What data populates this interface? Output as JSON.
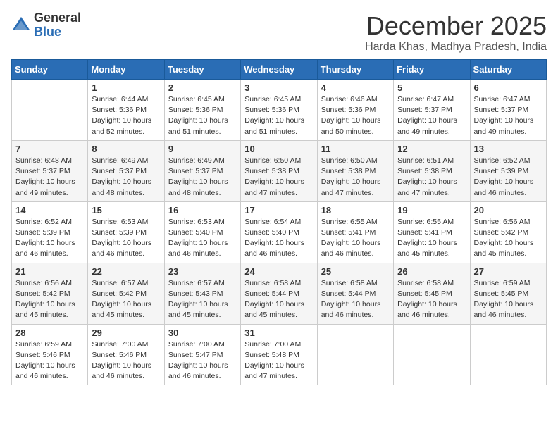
{
  "logo": {
    "general": "General",
    "blue": "Blue"
  },
  "header": {
    "month": "December 2025",
    "location": "Harda Khas, Madhya Pradesh, India"
  },
  "weekdays": [
    "Sunday",
    "Monday",
    "Tuesday",
    "Wednesday",
    "Thursday",
    "Friday",
    "Saturday"
  ],
  "weeks": [
    [
      {
        "day": "",
        "info": ""
      },
      {
        "day": "1",
        "info": "Sunrise: 6:44 AM\nSunset: 5:36 PM\nDaylight: 10 hours\nand 52 minutes."
      },
      {
        "day": "2",
        "info": "Sunrise: 6:45 AM\nSunset: 5:36 PM\nDaylight: 10 hours\nand 51 minutes."
      },
      {
        "day": "3",
        "info": "Sunrise: 6:45 AM\nSunset: 5:36 PM\nDaylight: 10 hours\nand 51 minutes."
      },
      {
        "day": "4",
        "info": "Sunrise: 6:46 AM\nSunset: 5:36 PM\nDaylight: 10 hours\nand 50 minutes."
      },
      {
        "day": "5",
        "info": "Sunrise: 6:47 AM\nSunset: 5:37 PM\nDaylight: 10 hours\nand 49 minutes."
      },
      {
        "day": "6",
        "info": "Sunrise: 6:47 AM\nSunset: 5:37 PM\nDaylight: 10 hours\nand 49 minutes."
      }
    ],
    [
      {
        "day": "7",
        "info": "Sunrise: 6:48 AM\nSunset: 5:37 PM\nDaylight: 10 hours\nand 49 minutes."
      },
      {
        "day": "8",
        "info": "Sunrise: 6:49 AM\nSunset: 5:37 PM\nDaylight: 10 hours\nand 48 minutes."
      },
      {
        "day": "9",
        "info": "Sunrise: 6:49 AM\nSunset: 5:37 PM\nDaylight: 10 hours\nand 48 minutes."
      },
      {
        "day": "10",
        "info": "Sunrise: 6:50 AM\nSunset: 5:38 PM\nDaylight: 10 hours\nand 47 minutes."
      },
      {
        "day": "11",
        "info": "Sunrise: 6:50 AM\nSunset: 5:38 PM\nDaylight: 10 hours\nand 47 minutes."
      },
      {
        "day": "12",
        "info": "Sunrise: 6:51 AM\nSunset: 5:38 PM\nDaylight: 10 hours\nand 47 minutes."
      },
      {
        "day": "13",
        "info": "Sunrise: 6:52 AM\nSunset: 5:39 PM\nDaylight: 10 hours\nand 46 minutes."
      }
    ],
    [
      {
        "day": "14",
        "info": "Sunrise: 6:52 AM\nSunset: 5:39 PM\nDaylight: 10 hours\nand 46 minutes."
      },
      {
        "day": "15",
        "info": "Sunrise: 6:53 AM\nSunset: 5:39 PM\nDaylight: 10 hours\nand 46 minutes."
      },
      {
        "day": "16",
        "info": "Sunrise: 6:53 AM\nSunset: 5:40 PM\nDaylight: 10 hours\nand 46 minutes."
      },
      {
        "day": "17",
        "info": "Sunrise: 6:54 AM\nSunset: 5:40 PM\nDaylight: 10 hours\nand 46 minutes."
      },
      {
        "day": "18",
        "info": "Sunrise: 6:55 AM\nSunset: 5:41 PM\nDaylight: 10 hours\nand 46 minutes."
      },
      {
        "day": "19",
        "info": "Sunrise: 6:55 AM\nSunset: 5:41 PM\nDaylight: 10 hours\nand 45 minutes."
      },
      {
        "day": "20",
        "info": "Sunrise: 6:56 AM\nSunset: 5:42 PM\nDaylight: 10 hours\nand 45 minutes."
      }
    ],
    [
      {
        "day": "21",
        "info": "Sunrise: 6:56 AM\nSunset: 5:42 PM\nDaylight: 10 hours\nand 45 minutes."
      },
      {
        "day": "22",
        "info": "Sunrise: 6:57 AM\nSunset: 5:42 PM\nDaylight: 10 hours\nand 45 minutes."
      },
      {
        "day": "23",
        "info": "Sunrise: 6:57 AM\nSunset: 5:43 PM\nDaylight: 10 hours\nand 45 minutes."
      },
      {
        "day": "24",
        "info": "Sunrise: 6:58 AM\nSunset: 5:44 PM\nDaylight: 10 hours\nand 45 minutes."
      },
      {
        "day": "25",
        "info": "Sunrise: 6:58 AM\nSunset: 5:44 PM\nDaylight: 10 hours\nand 46 minutes."
      },
      {
        "day": "26",
        "info": "Sunrise: 6:58 AM\nSunset: 5:45 PM\nDaylight: 10 hours\nand 46 minutes."
      },
      {
        "day": "27",
        "info": "Sunrise: 6:59 AM\nSunset: 5:45 PM\nDaylight: 10 hours\nand 46 minutes."
      }
    ],
    [
      {
        "day": "28",
        "info": "Sunrise: 6:59 AM\nSunset: 5:46 PM\nDaylight: 10 hours\nand 46 minutes."
      },
      {
        "day": "29",
        "info": "Sunrise: 7:00 AM\nSunset: 5:46 PM\nDaylight: 10 hours\nand 46 minutes."
      },
      {
        "day": "30",
        "info": "Sunrise: 7:00 AM\nSunset: 5:47 PM\nDaylight: 10 hours\nand 46 minutes."
      },
      {
        "day": "31",
        "info": "Sunrise: 7:00 AM\nSunset: 5:48 PM\nDaylight: 10 hours\nand 47 minutes."
      },
      {
        "day": "",
        "info": ""
      },
      {
        "day": "",
        "info": ""
      },
      {
        "day": "",
        "info": ""
      }
    ]
  ]
}
